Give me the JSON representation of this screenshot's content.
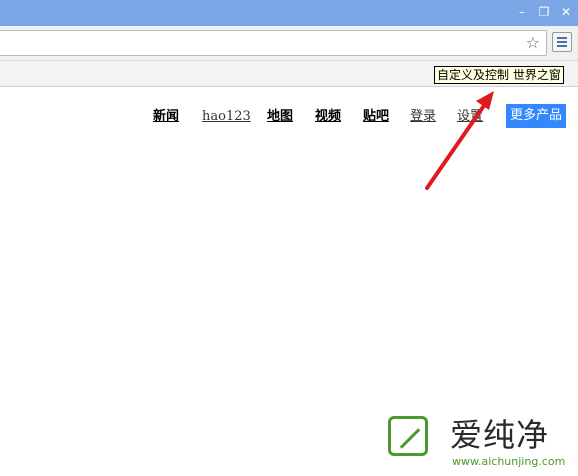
{
  "window": {
    "minimize_glyph": "–",
    "restore_glyph": "❐",
    "close_glyph": "✕"
  },
  "toolbar": {
    "address_value": "",
    "star_icon": "star-icon",
    "menu_icon": "hamburger-menu-icon"
  },
  "tooltip": {
    "text": "自定义及控制 世界之窗"
  },
  "nav": {
    "links": [
      {
        "label": "新闻"
      },
      {
        "label": "hao123"
      },
      {
        "label": "地图"
      },
      {
        "label": "视频"
      },
      {
        "label": "贴吧"
      },
      {
        "label": "登录"
      },
      {
        "label": "设置"
      }
    ],
    "more_products": "更多产品"
  },
  "watermark": {
    "title": "爱纯净",
    "url": "www.aichunjing.com"
  },
  "colors": {
    "titlebar": "#7aa6e6",
    "arrow": "#e0191e",
    "more_products_bg": "#3388ff",
    "watermark_green": "#4a9a2e"
  }
}
